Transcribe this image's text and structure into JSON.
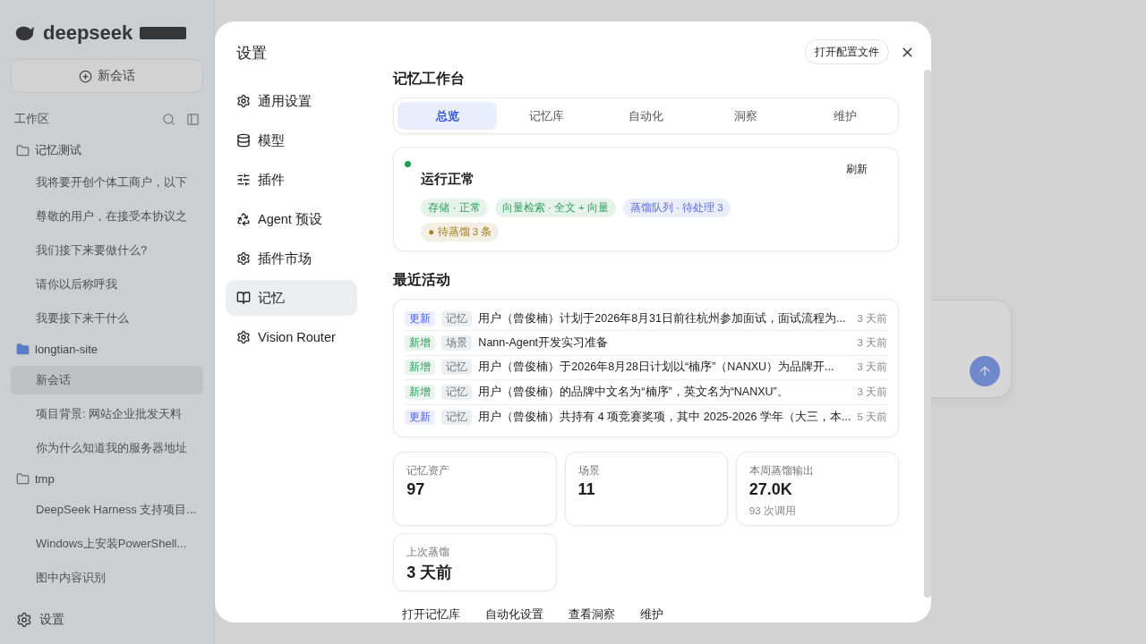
{
  "background": {
    "brand": "deepseek",
    "new_chat": "新会话",
    "workspace_label": "工作区",
    "groups": [
      {
        "name": "记忆测试",
        "highlighted": false,
        "chats": [
          {
            "title": "我将要开创个体工商户，以下",
            "selected": false
          },
          {
            "title": "尊敬的用户，在接受本协议之",
            "selected": false
          },
          {
            "title": "我们接下来要做什么?",
            "selected": false
          },
          {
            "title": "请你以后称呼我",
            "selected": false
          },
          {
            "title": "我要接下来干什么",
            "selected": false
          }
        ]
      },
      {
        "name": "longtian-site",
        "highlighted": true,
        "chats": [
          {
            "title": "新会话",
            "selected": true
          },
          {
            "title": "项目背景: 网站企业批发天料",
            "selected": false
          },
          {
            "title": "你为什么知道我的服务器地址",
            "selected": false
          }
        ]
      },
      {
        "name": "tmp",
        "highlighted": false,
        "chats": [
          {
            "title": "DeepSeek Harness 支持项目...",
            "selected": false
          },
          {
            "title": "Windows上安装PowerShell...",
            "selected": false
          },
          {
            "title": "图中内容识别",
            "selected": false
          }
        ]
      }
    ],
    "settings_label": "设置"
  },
  "dialog": {
    "title": "设置",
    "open_config": "打开配置文件",
    "nav": [
      {
        "label": "通用设置",
        "selected": false
      },
      {
        "label": "模型",
        "selected": false
      },
      {
        "label": "插件",
        "selected": false
      },
      {
        "label": "Agent 预设",
        "selected": false
      },
      {
        "label": "插件市场",
        "selected": false
      },
      {
        "label": "记忆",
        "selected": true
      },
      {
        "label": "Vision Router",
        "selected": false
      }
    ],
    "heading": "记忆工作台",
    "tabs": [
      {
        "label": "总览",
        "selected": true
      },
      {
        "label": "记忆库",
        "selected": false
      },
      {
        "label": "自动化",
        "selected": false
      },
      {
        "label": "洞察",
        "selected": false
      },
      {
        "label": "维护",
        "selected": false
      }
    ],
    "status": {
      "title": "运行正常",
      "color": "#1f9d55",
      "refresh": "刷新",
      "chips": [
        {
          "label": "存储 · 正常",
          "kind": "ok"
        },
        {
          "label": "向量检索 · 全文 + 向量",
          "kind": "ok"
        },
        {
          "label": "蒸馏队列 · 待处理 3",
          "kind": "info"
        },
        {
          "label": "● 待蒸馏 3 条",
          "kind": "warn"
        }
      ]
    },
    "activity_heading": "最近活动",
    "activity": [
      {
        "action": "更新",
        "kind": "update",
        "type": "记忆",
        "text": "用户（曾俊楠）计划于2026年8月31日前往杭州参加面试，面试流程为...",
        "time": "3 天前"
      },
      {
        "action": "新增",
        "kind": "add",
        "type": "场景",
        "text": "Nann-Agent开发实习准备",
        "time": "3 天前"
      },
      {
        "action": "新增",
        "kind": "add",
        "type": "记忆",
        "text": "用户（曾俊楠）于2026年8月28日计划以“楠序”（NANXU）为品牌开...",
        "time": "3 天前"
      },
      {
        "action": "新增",
        "kind": "add",
        "type": "记忆",
        "text": "用户（曾俊楠）的品牌中文名为“楠序”，英文名为“NANXU”。",
        "time": "3 天前"
      },
      {
        "action": "更新",
        "kind": "update",
        "type": "记忆",
        "text": "用户（曾俊楠）共持有 4 项竞赛奖项，其中 2025-2026 学年（大三，本...",
        "time": "5 天前"
      }
    ],
    "stats": [
      {
        "label": "记忆资产",
        "value": "97"
      },
      {
        "label": "场景",
        "value": "11"
      },
      {
        "label": "本周蒸馏输出",
        "value": "27.0K",
        "note": "93 次调用"
      },
      {
        "label": "上次蒸馏",
        "value": "3 天前"
      }
    ],
    "actions": [
      "打开记忆库",
      "自动化设置",
      "查看洞察",
      "维护"
    ]
  }
}
